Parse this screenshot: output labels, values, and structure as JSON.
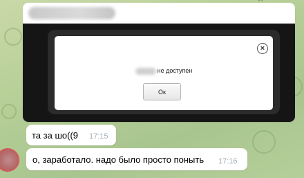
{
  "chat": {
    "forwarded_image": {
      "sender_name": "",
      "dialog": {
        "message": "не доступен",
        "ok_label": "Ок",
        "close_glyph": "×"
      }
    },
    "messages": [
      {
        "text": "та за шо((9",
        "time": "17:15"
      },
      {
        "text": "о, заработало. надо было просто поныть",
        "time": "17:16"
      }
    ]
  },
  "icons": {
    "close": "close-icon",
    "avatar": "avatar"
  },
  "colors": {
    "chat_background": "#b7cf98",
    "bubble": "#ffffff",
    "timestamp": "#a0acb6",
    "dialog_frame": "#2b2b2b"
  }
}
